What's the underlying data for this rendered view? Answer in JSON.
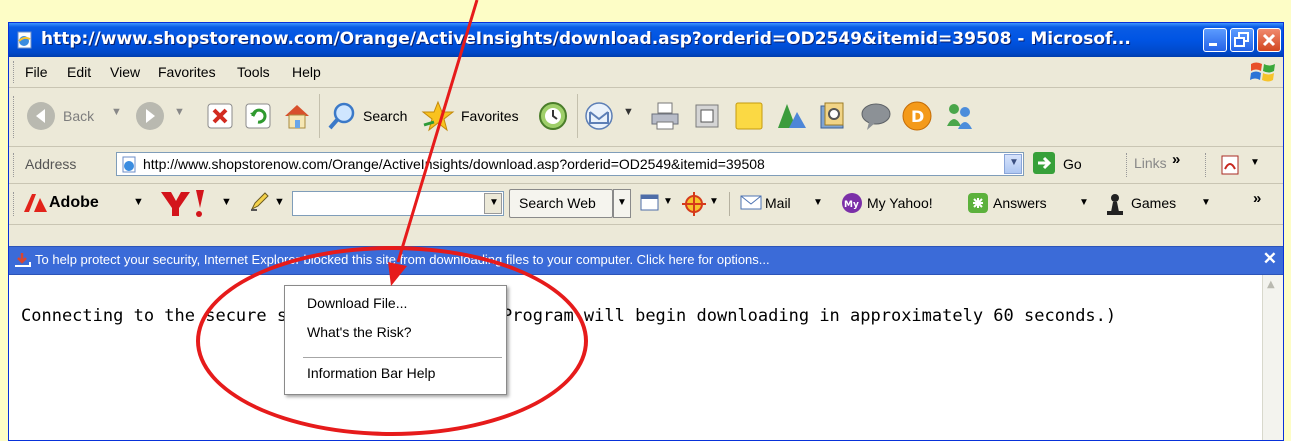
{
  "window": {
    "title": "http://www.shopstorenow.com/Orange/ActiveInsights/download.asp?orderid=OD2549&itemid=39508 - Microsof..."
  },
  "menubar": {
    "items": [
      "File",
      "Edit",
      "View",
      "Favorites",
      "Tools",
      "Help"
    ]
  },
  "toolbar": {
    "back_label": "Back",
    "search_label": "Search",
    "favorites_label": "Favorites"
  },
  "address": {
    "label": "Address",
    "url": "http://www.shopstorenow.com/Orange/ActiveInsights/download.asp?orderid=OD2549&itemid=39508",
    "go_label": "Go",
    "links_label": "Links"
  },
  "yahoo_toolbar": {
    "adobe_label": "Adobe",
    "search_web_label": "Search Web",
    "mail_label": "Mail",
    "my_yahoo_label": "My Yahoo!",
    "answers_label": "Answers",
    "games_label": "Games"
  },
  "infobar": {
    "text": "To help protect your security, Internet Explorer blocked this site from downloading files to your computer. Click here for options..."
  },
  "content": {
    "message": "Connecting to the secure server. Please wait. (Program will begin downloading in approximately 60 seconds.)"
  },
  "context_menu": {
    "items": [
      "Download File...",
      "What's the Risk?",
      "Information Bar Help"
    ]
  },
  "colors": {
    "annotation": "#e61b1b",
    "title_bar": "#0054e3",
    "info_bar": "#3b6bd8",
    "background": "#fdfdc6"
  }
}
